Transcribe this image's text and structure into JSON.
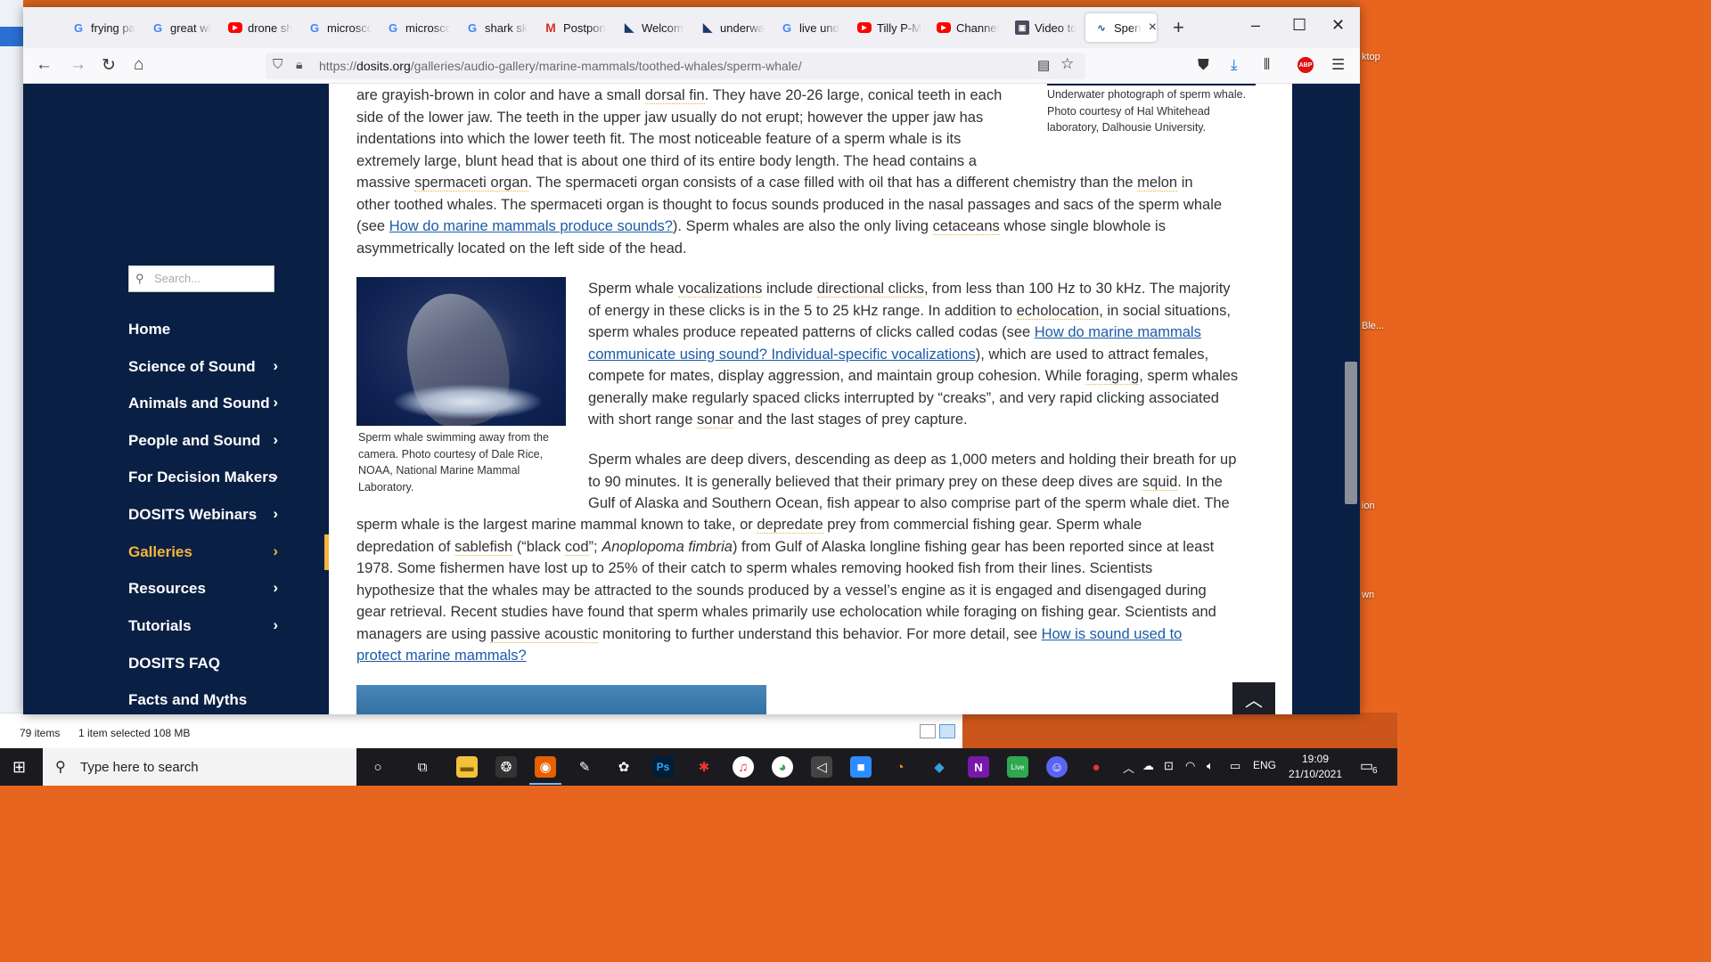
{
  "browser": {
    "tabs": [
      {
        "label": "frying pa",
        "icon": "google-icon"
      },
      {
        "label": "great wi",
        "icon": "google-icon"
      },
      {
        "label": "drone sh",
        "icon": "youtube-icon"
      },
      {
        "label": "microsco",
        "icon": "google-icon"
      },
      {
        "label": "microsco",
        "icon": "google-icon"
      },
      {
        "label": "shark sk",
        "icon": "google-icon"
      },
      {
        "label": "Postpon",
        "icon": "gmail-icon"
      },
      {
        "label": "Welcom",
        "icon": "dosits-icon"
      },
      {
        "label": "underwa",
        "icon": "dosits-icon"
      },
      {
        "label": "live und",
        "icon": "google-icon"
      },
      {
        "label": "Tilly P-M",
        "icon": "youtube-icon"
      },
      {
        "label": "Channel",
        "icon": "youtube-icon"
      },
      {
        "label": "Video to",
        "icon": "video-icon"
      },
      {
        "label": "Sperm",
        "icon": "soundwave-icon",
        "active": true
      }
    ],
    "url_prefix": "https://",
    "url_domain": "dosits.org",
    "url_path": "/galleries/audio-gallery/marine-mammals/toothed-whales/sperm-whale/"
  },
  "sidebar": {
    "search_placeholder": "Search...",
    "items": [
      {
        "label": "Home",
        "chevron": ""
      },
      {
        "label": "Science of Sound",
        "chevron": "›"
      },
      {
        "label": "Animals and Sound",
        "chevron": "›"
      },
      {
        "label": "People and Sound",
        "chevron": "›"
      },
      {
        "label": "For Decision Makers",
        "chevron": "›"
      },
      {
        "label": "DOSITS Webinars",
        "chevron": "›"
      },
      {
        "label": "Galleries",
        "chevron": "›",
        "active": true
      },
      {
        "label": "Resources",
        "chevron": "›"
      },
      {
        "label": "Tutorials",
        "chevron": "›"
      },
      {
        "label": "DOSITS FAQ",
        "chevron": ""
      },
      {
        "label": "Facts and Myths",
        "chevron": ""
      }
    ]
  },
  "content": {
    "caption_top": "Underwater photograph of sperm whale. Photo courtesy of Hal Whitehead laboratory, Dalhousie University.",
    "caption_photo": "Sperm whale swimming away from the camera. Photo courtesy of Dale Rice, NOAA, National Marine Mammal Laboratory.",
    "p1": {
      "l1a": "are grayish-brown in color and have a small ",
      "l1b": "dorsal fin",
      "l1c": ". They have 20-26 large, conical teeth in each",
      "l2": "side of the lower jaw. The teeth in the upper jaw usually do not erupt; however the upper jaw has",
      "l3": "indentations into which the lower teeth fit. The most noticeable feature of a sperm whale is its",
      "l4": "extremely large, blunt head that is about one third of its entire body length. The head contains a",
      "l5a": "massive ",
      "l5b": "spermaceti organ",
      "l5c": ". The spermaceti organ consists of a case filled with oil that has a different chemistry than the ",
      "l5d": "melon",
      "l5e": " in",
      "l6": "other toothed whales. The spermaceti organ is thought to focus sounds produced in the nasal passages and sacs of the sperm whale",
      "l7a": "(see ",
      "l7b": "How do marine mammals produce sounds?",
      "l7c": "). Sperm whales are also the only living ",
      "l7d": "cetaceans",
      "l7e": " whose single blowhole is",
      "l8": "asymmetrically located on the left side of the head."
    },
    "p2": {
      "l1a": "Sperm whale ",
      "l1b": "vocalizations",
      "l1c": " include ",
      "l1d": "directional clicks",
      "l1e": ", from less than 100 Hz to 30 kHz. The majority",
      "l2a": "of energy in these clicks is in the 5 to 25 kHz range. In addition to ",
      "l2b": "echolocation",
      "l2c": ", in social situations,",
      "l3a": "sperm whales produce repeated patterns of clicks called codas (see ",
      "l3b": "How do marine mammals",
      "l4a": "communicate using sound? Individual-specific vocalizations",
      "l4b": "), which are used to attract females,",
      "l5": "compete for mates, display aggression, and maintain group cohesion. While ",
      "l5b": "foraging",
      "l5c": ", sperm whales",
      "l6": "generally make regularly spaced clicks interrupted by “creaks”, and very rapid clicking associated",
      "l7a": "with short range ",
      "l7b": "sonar",
      "l7c": " and the last stages of prey capture."
    },
    "p3": {
      "l1": "Sperm whales are deep divers, descending as deep as 1,000 meters and holding their breath for up",
      "l2a": "to 90 minutes. It is generally believed that their primary prey on these deep dives are ",
      "l2b": "squid",
      "l2c": ". In the",
      "l3": "Gulf of Alaska and Southern Ocean, fish appear to also comprise part of the sperm whale diet. The",
      "l4a": "sperm whale is the largest marine mammal known to take, or ",
      "l4b": "depredate",
      "l4c": " prey from commercial fishing gear. Sperm whale",
      "l5a": "depredation of ",
      "l5b": "sablefish",
      "l5c": " (“black ",
      "l5d": "cod",
      "l5e": "”; ",
      "l5f": "Anoplopoma fimbria",
      "l5g": ") from Gulf of Alaska longline fishing gear has been reported since at least",
      "l6": "1978. Some fishermen have lost up to 25% of their catch to sperm whales removing hooked fish from their lines. Scientists",
      "l7": "hypothesize that the whales may be attracted to the sounds produced by a vessel’s engine as it is engaged and disengaged during",
      "l8": "gear retrieval. Recent studies have found that sperm whales primarily use echolocation while foraging on fishing gear. Scientists and",
      "l9a": "managers are using ",
      "l9b": "passive acoustic",
      "l9c": " monitoring to further understand this behavior. For more detail, see ",
      "l9d": "How is sound used to",
      "l10": "protect marine mammals?"
    }
  },
  "explorer": {
    "items": "79 items",
    "selected": "1 item selected  108 MB"
  },
  "taskbar": {
    "search_placeholder": "Type here to search",
    "lang": "ENG",
    "time": "19:09",
    "date": "21/10/2021",
    "notifications": "6"
  },
  "desktop_labels": [
    "ktop",
    "Ble...",
    "ion",
    "wn"
  ]
}
